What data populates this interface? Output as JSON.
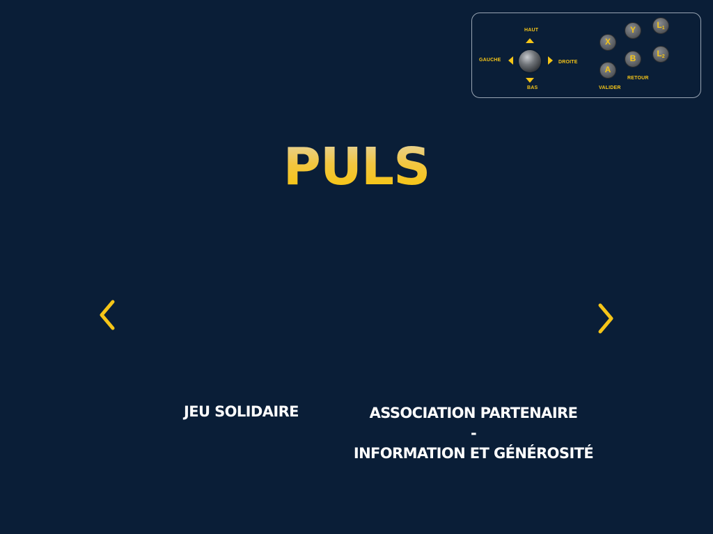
{
  "controller": {
    "directions": {
      "up": "HAUT",
      "down": "BAS",
      "left": "GAUCHE",
      "right": "DROITE"
    },
    "buttons": {
      "x": "X",
      "y": "Y",
      "a": "A",
      "b": "B",
      "l1": "L",
      "l1_sub": "1",
      "l2": "L",
      "l2_sub": "2"
    },
    "captions": {
      "a": "VALIDER",
      "b": "RETOUR"
    },
    "icons": {
      "joystick": "joystick-icon",
      "arrow_up": "arrow-up-icon",
      "arrow_down": "arrow-down-icon",
      "arrow_left": "arrow-left-icon",
      "arrow_right": "arrow-right-icon"
    }
  },
  "title": "PULS",
  "navigation": {
    "prev_icon": "chevron-left-icon",
    "next_icon": "chevron-right-icon"
  },
  "menu": {
    "left_item": "JEU SOLIDAIRE",
    "right_item": {
      "line1": "ASSOCIATION PARTENAIRE",
      "separator": "-",
      "line2": "INFORMATION ET GÉNÉROSITÉ"
    }
  },
  "colors": {
    "background": "#0a1e37",
    "accent": "#f5c518",
    "text": "#ffffff",
    "panel_border": "#9aa6b4"
  }
}
